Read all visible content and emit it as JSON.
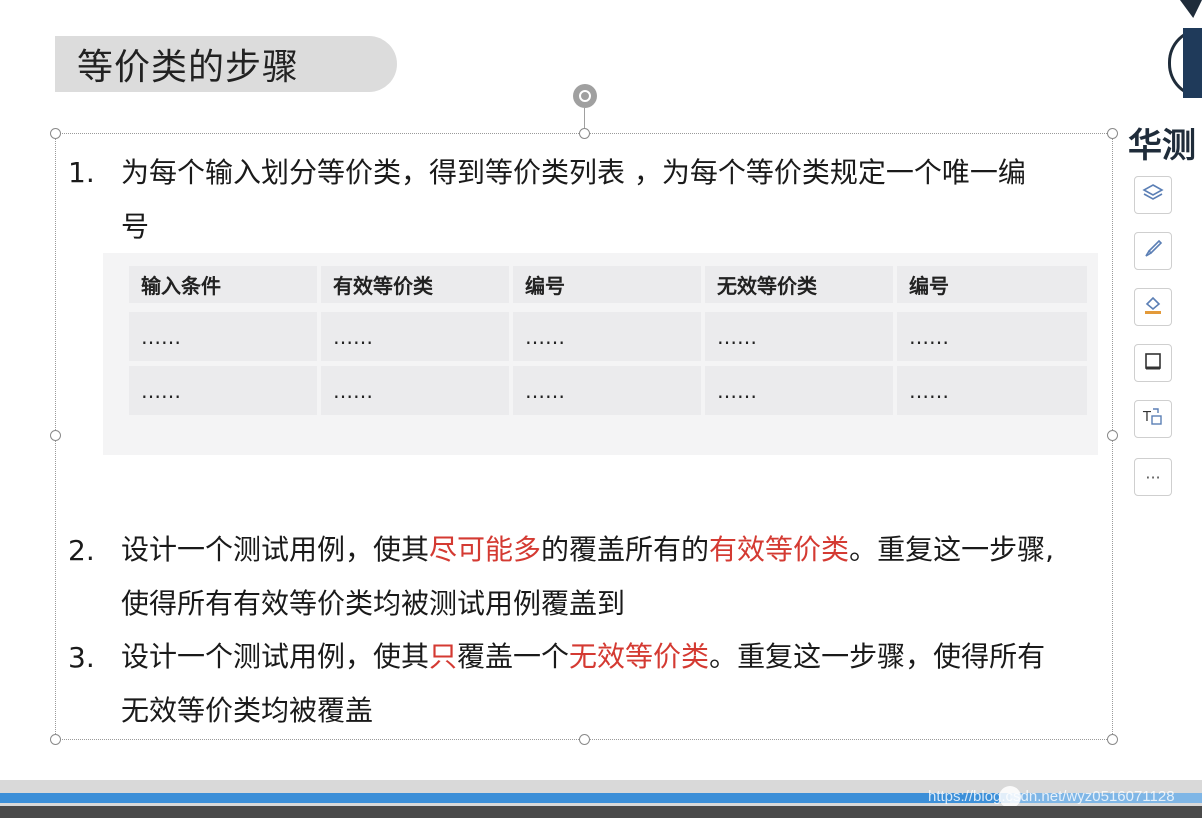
{
  "slide": {
    "title": "等价类的步骤",
    "steps": [
      {
        "number": "1.",
        "line1": "为每个输入划分等价类，得到等价类列表 ，为每个等价类规定一个唯一编",
        "line2": "号"
      },
      {
        "number": "2.",
        "line1_a": "设计一个测试用例，使其",
        "line1_b": "尽可能多",
        "line1_c": "的覆盖所有的",
        "line1_d": "有效等价类",
        "line1_e": "。重复这一步骤,",
        "line2": "使得所有有效等价类均被测试用例覆盖到"
      },
      {
        "number": "3.",
        "line1_a": "设计一个测试用例，使其",
        "line1_b": "只",
        "line1_c": "覆盖一个",
        "line1_d": "无效等价类",
        "line1_e": "。重复这一步骤，使得所有",
        "line2": "无效等价类均被覆盖"
      }
    ],
    "table": {
      "headers": [
        "输入条件",
        "有效等价类",
        "编号",
        "无效等价类",
        "编号"
      ],
      "rows": [
        [
          "……",
          "……",
          "……",
          "……",
          "……"
        ],
        [
          "……",
          "……",
          "……",
          "……",
          "……"
        ]
      ]
    },
    "emphasis_color": "#d43a32"
  },
  "brand": {
    "text": "华测"
  },
  "toolbar": {
    "items": [
      {
        "icon": "layers-icon"
      },
      {
        "icon": "brush-icon"
      },
      {
        "icon": "fill-icon"
      },
      {
        "icon": "border-icon"
      },
      {
        "icon": "text-transform-icon"
      },
      {
        "icon": "more-icon",
        "label": "···"
      }
    ]
  },
  "player": {
    "progress": 0.84,
    "watermark": "https://blog.csdn.net/wyz0516071128"
  }
}
